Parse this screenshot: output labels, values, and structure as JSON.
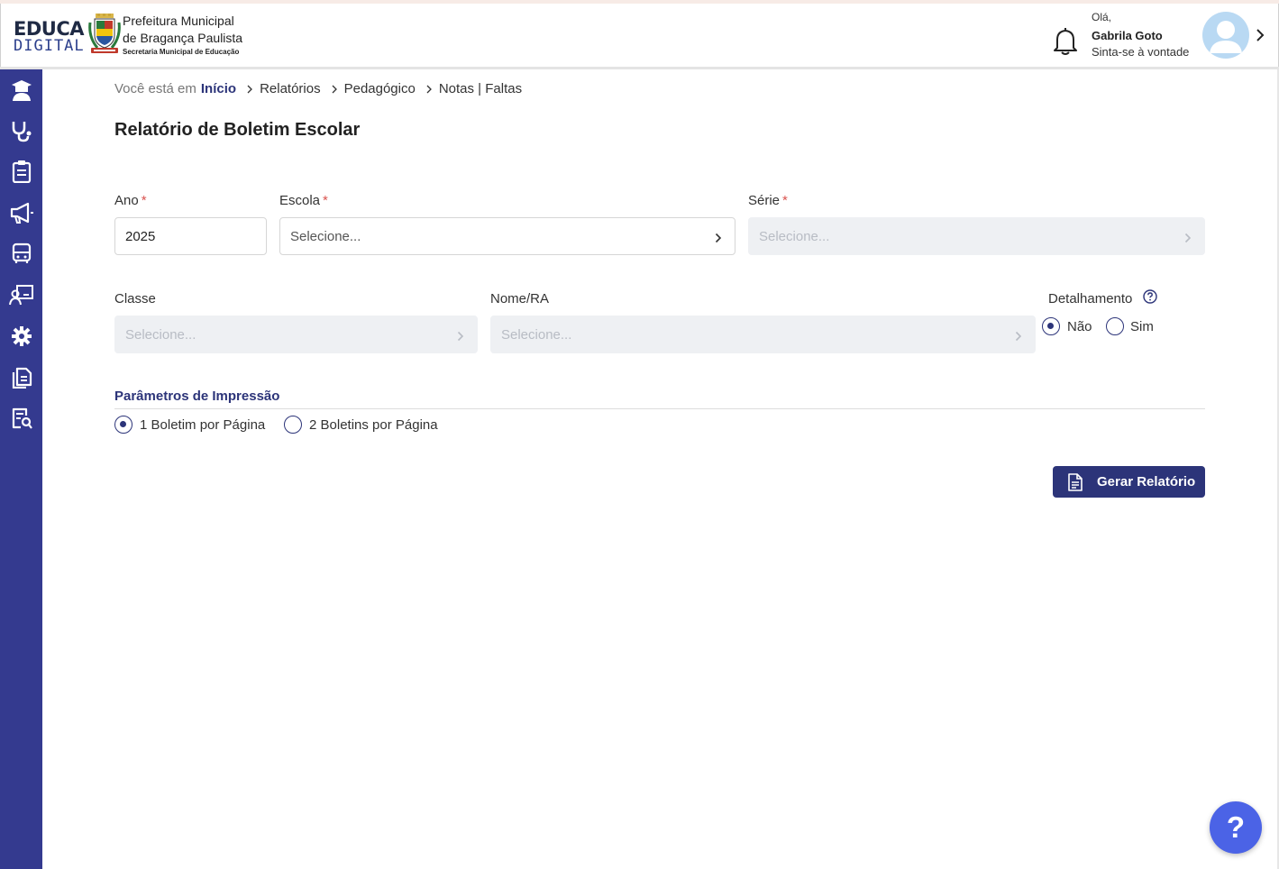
{
  "header": {
    "logo_line1": "EDUCA",
    "logo_line2": "DIGITAL",
    "org_line1": "Prefeitura Municipal",
    "org_line2": "de Bragança Paulista",
    "org_line3": "Secretaria Municipal de Educação",
    "greeting": "Olá,",
    "user_name": "Gabrila Goto",
    "user_subtitle": "Sinta-se à vontade"
  },
  "sidebar": {
    "items": [
      {
        "icon": "student-icon"
      },
      {
        "icon": "health-icon"
      },
      {
        "icon": "clipboard-icon"
      },
      {
        "icon": "megaphone-icon"
      },
      {
        "icon": "bus-icon"
      },
      {
        "icon": "teacher-board-icon"
      },
      {
        "icon": "gear-icon"
      },
      {
        "icon": "documents-icon"
      },
      {
        "icon": "report-search-icon"
      }
    ]
  },
  "breadcrumb": {
    "prefix": "Você está em",
    "home": "Início",
    "items": [
      "Relatórios",
      "Pedagógico",
      "Notas | Faltas"
    ]
  },
  "page": {
    "title": "Relatório de Boletim Escolar"
  },
  "form": {
    "ano": {
      "label": "Ano",
      "required": "*",
      "value": "2025"
    },
    "escola": {
      "label": "Escola",
      "required": "*",
      "placeholder": "Selecione..."
    },
    "serie": {
      "label": "Série",
      "required": "*",
      "placeholder": "Selecione..."
    },
    "classe": {
      "label": "Classe",
      "placeholder": "Selecione..."
    },
    "nome_ra": {
      "label": "Nome/RA",
      "placeholder": "Selecione..."
    },
    "detalhamento": {
      "label": "Detalhamento",
      "options": [
        "Não",
        "Sim"
      ],
      "selected": "Não"
    }
  },
  "print_params": {
    "title": "Parâmetros de Impressão",
    "options": [
      "1 Boletim por Página",
      "2 Boletins por Página"
    ],
    "selected": "1 Boletim por Página"
  },
  "actions": {
    "generate_label": "Gerar Relatório"
  },
  "help": {
    "label": "?"
  },
  "colors": {
    "primary": "#2c3479",
    "sidebar": "#343a8f",
    "help_button": "#4b63e6",
    "required": "#d9534f"
  }
}
